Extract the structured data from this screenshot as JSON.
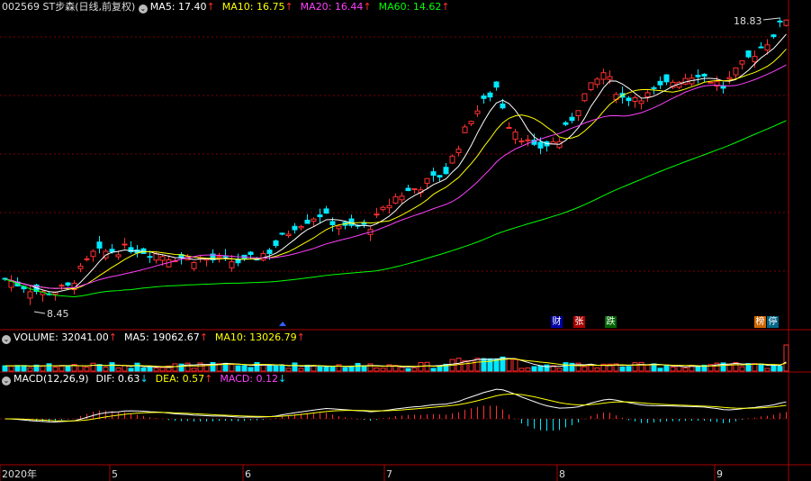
{
  "title": {
    "code_name": "002569 ST步森",
    "mode": "(日线,前复权)"
  },
  "price_ma": [
    {
      "label": "MA5:",
      "value": "17.40",
      "arrow": "↑",
      "color": "#ffffff"
    },
    {
      "label": "MA10:",
      "value": "16.75",
      "arrow": "↑",
      "color": "#ffff00"
    },
    {
      "label": "MA20:",
      "value": "16.44",
      "arrow": "↑",
      "color": "#ff40ff"
    },
    {
      "label": "MA60:",
      "value": "14.62",
      "arrow": "↑",
      "color": "#00ff00"
    }
  ],
  "volume_header": [
    {
      "label": "VOLUME:",
      "value": "32041.00",
      "arrow": "↑",
      "color": "#ffffff"
    },
    {
      "label": "MA5:",
      "value": "19062.67",
      "arrow": "↑",
      "color": "#ffffff"
    },
    {
      "label": "MA10:",
      "value": "13026.79",
      "arrow": "↑",
      "color": "#ffff00"
    }
  ],
  "macd_header": [
    {
      "label": "MACD(12,26,9)",
      "value": "",
      "arrow": "",
      "color": "#ffffff"
    },
    {
      "label": "DIF:",
      "value": "0.63",
      "arrow": "↓",
      "color": "#ffffff"
    },
    {
      "label": "DEA:",
      "value": "0.57",
      "arrow": "↑",
      "color": "#ffff00"
    },
    {
      "label": "MACD:",
      "value": "0.12",
      "arrow": "↓",
      "color": "#ff40ff"
    }
  ],
  "markers": [
    {
      "text": "财",
      "bg": "#0000aa",
      "fg": "#ffffff"
    },
    {
      "text": "张",
      "bg": "#aa0000",
      "fg": "#ffffff"
    },
    {
      "text": "跌",
      "bg": "#006600",
      "fg": "#ffffff"
    },
    {
      "text": "榜",
      "bg": "#cc6600",
      "fg": "#ffffff"
    },
    {
      "text": "停",
      "bg": "#006688",
      "fg": "#ffffff"
    }
  ],
  "chart_data": {
    "type": "candlestick",
    "price_range": [
      8.45,
      18.83
    ],
    "high_label": "18.83",
    "low_label": "8.45",
    "x_tick_labels": [
      "2020年",
      "5",
      "6",
      "7",
      "8",
      "9"
    ],
    "colors": {
      "up": "#ff3030",
      "down": "#00e8ff",
      "ma5": "#ffffff",
      "ma10": "#ffff00",
      "ma20": "#ff40ff",
      "ma60": "#00ff00"
    },
    "macd": {
      "dif": 0.63,
      "dea": 0.57,
      "macd": 0.12
    }
  }
}
